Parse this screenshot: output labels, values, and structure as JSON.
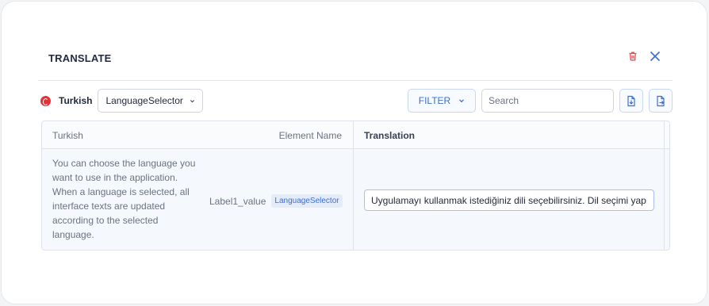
{
  "dialog": {
    "title": "TRANSLATE",
    "icons": {
      "delete": "trash-icon",
      "close": "close-icon"
    }
  },
  "toolbar": {
    "language_flag": "turkey-flag-icon",
    "language_name": "Turkish",
    "selector_value": "LanguageSelector",
    "filter_label": "FILTER",
    "search_placeholder": "Search",
    "import_icon": "file-import-icon",
    "export_icon": "file-export-icon"
  },
  "table": {
    "columns": {
      "source": "Turkish",
      "element": "Element Name",
      "translation": "Translation"
    },
    "rows": [
      {
        "source_text": "You can choose the language you want to use in the application. When a language is selected, all interface texts are updated according to the selected language.",
        "element_key": "Label1_value",
        "element_badge": "LanguageSelector",
        "translation": "Uygulamayı kullanmak istediğiniz dili seçebilirsiniz. Dil seçimi yapıldığında"
      }
    ]
  },
  "colors": {
    "accent": "#3b6fd3",
    "danger": "#e05252",
    "row_highlight": "#f5f8fd"
  }
}
